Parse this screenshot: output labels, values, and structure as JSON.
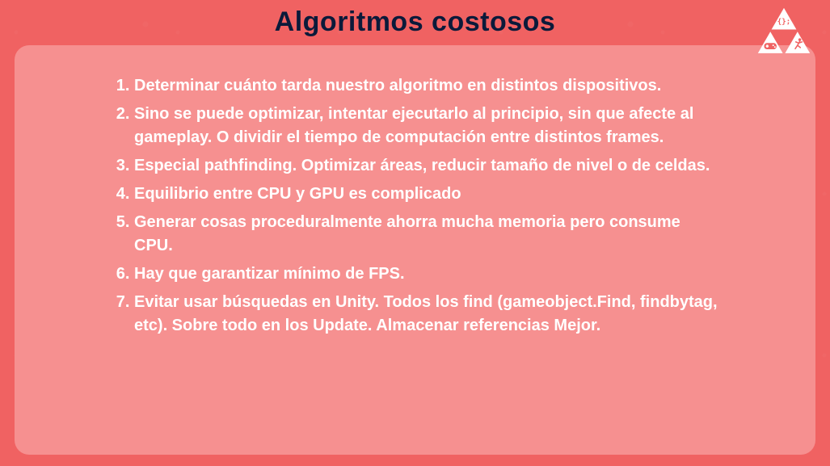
{
  "title": "Algoritmos costosos",
  "points": [
    "Determinar cuánto tarda nuestro algoritmo en distintos dispositivos.",
    "Sino se puede optimizar, intentar ejecutarlo al principio, sin que afecte al gameplay. O dividir el tiempo de computación entre distintos frames.",
    "Especial pathfinding. Optimizar áreas, reducir tamaño de nivel o de celdas.",
    "Equilibrio entre CPU y GPU es complicado",
    "Generar cosas proceduralmente ahorra mucha memoria pero consume CPU.",
    "Hay que garantizar mínimo de FPS.",
    "Evitar usar búsquedas en Unity. Todos los find (gameobject.Find, findbytag, etc). Sobre todo en los Update. Almacenar referencias Mejor."
  ],
  "logo": {
    "color": "#ffffff",
    "icons": [
      "code-icon",
      "gamepad-icon",
      "running-icon"
    ]
  }
}
